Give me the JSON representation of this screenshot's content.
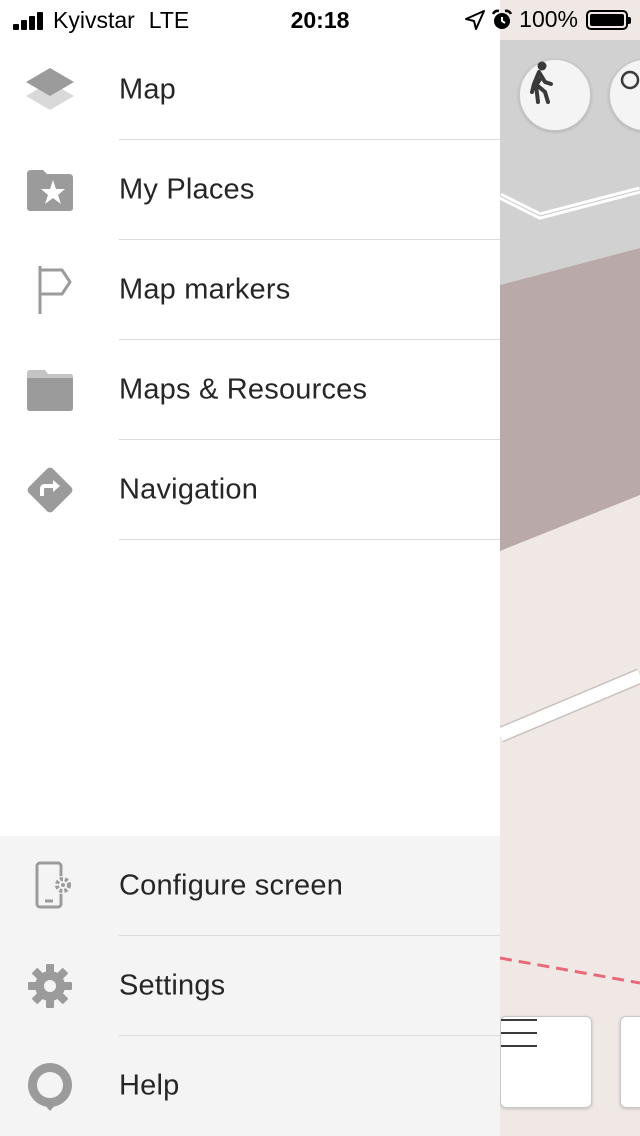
{
  "status_bar": {
    "carrier": "Kyivstar",
    "network": "LTE",
    "time": "20:18",
    "battery": "100%",
    "battery_level": 1.0,
    "signal_bars": 4,
    "icons": [
      "signal-icon",
      "location-arrow-icon",
      "alarm-icon",
      "battery-icon"
    ]
  },
  "drawer": {
    "top_items": [
      {
        "label": "Map",
        "icon": "layers-icon"
      },
      {
        "label": "My Places",
        "icon": "star-folder-icon"
      },
      {
        "label": "Map markers",
        "icon": "flag-icon"
      },
      {
        "label": "Maps & Resources",
        "icon": "folder-icon"
      },
      {
        "label": "Navigation",
        "icon": "direction-sign-icon"
      }
    ],
    "bottom_items": [
      {
        "label": "Configure screen",
        "icon": "phone-settings-icon"
      },
      {
        "label": "Settings",
        "icon": "gear-icon"
      },
      {
        "label": "Help",
        "icon": "help-pin-icon"
      }
    ]
  },
  "map": {
    "buttons": [
      "pedestrian-mode-icon",
      "compass-icon",
      "hamburger-menu-icon"
    ]
  },
  "colors": {
    "icon_gray": "#9b9b9b",
    "text": "#262626",
    "drawer_bottom_bg": "#f4f4f4",
    "divider": "#dcdcdc",
    "map_gray": "#d1d1d1",
    "map_mauve": "#baa9a9",
    "map_beige": "#efe8e4",
    "route_dash": "#e86a7a"
  }
}
